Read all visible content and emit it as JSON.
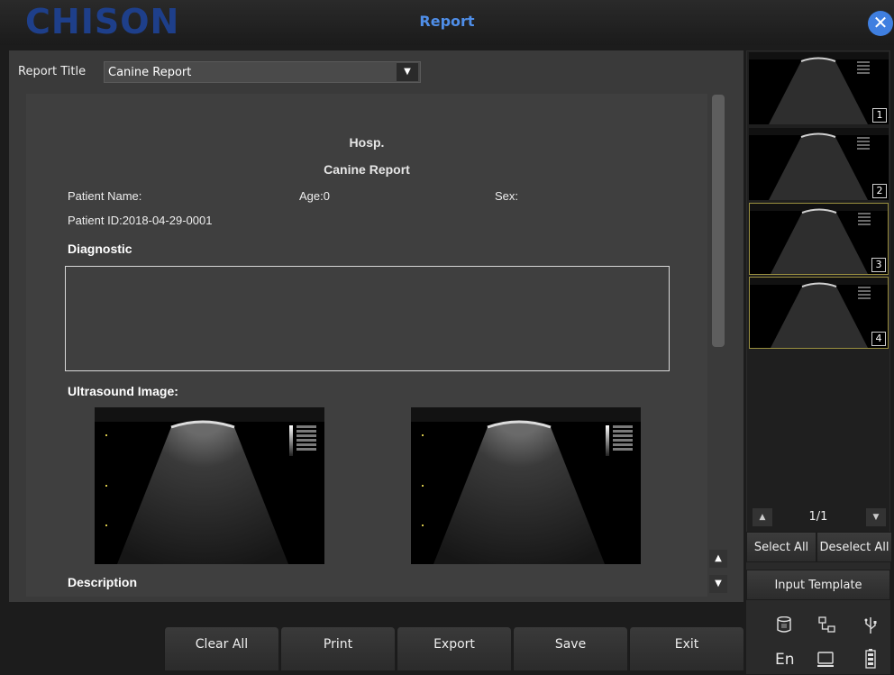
{
  "header": {
    "logo_text": "CHISON",
    "title": "Report",
    "close_icon": "close-icon"
  },
  "report_title": {
    "label": "Report Title",
    "value": "Canine Report"
  },
  "report": {
    "hospital": "Hosp.",
    "title": "Canine Report",
    "patient_name_label": "Patient Name:",
    "age_label": "Age:0",
    "sex_label": "Sex:",
    "patient_id": "Patient ID:2018-04-29-0001",
    "diagnostic_heading": "Diagnostic",
    "ultrasound_heading": "Ultrasound Image:",
    "description_heading": "Description",
    "images": [
      {
        "index": 1
      },
      {
        "index": 2
      }
    ]
  },
  "buttons": {
    "clear_all": "Clear All",
    "print": "Print",
    "export": "Export",
    "save": "Save",
    "exit": "Exit"
  },
  "thumbnails": [
    {
      "number": "1",
      "selected": false
    },
    {
      "number": "2",
      "selected": false
    },
    {
      "number": "3",
      "selected": true
    },
    {
      "number": "4",
      "selected": true
    }
  ],
  "pager": {
    "text": "1/1"
  },
  "side_buttons": {
    "select_all": "Select All",
    "deselect_all": "Deselect All",
    "input_template": "Input Template"
  },
  "status": {
    "language": "En",
    "icons": [
      "database-icon",
      "network-icon",
      "usb-icon",
      "monitor-icon",
      "battery-icon"
    ]
  },
  "colors": {
    "accent": "#3f7fe0",
    "title_text": "#4f8ee8",
    "selection_border": "#9b9040",
    "background": "#1c1c1c"
  }
}
